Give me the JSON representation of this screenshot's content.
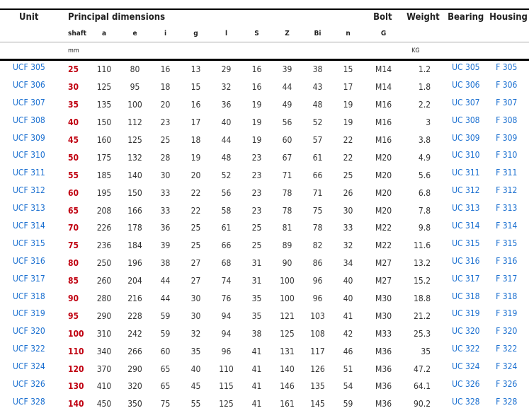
{
  "header": {
    "unit": "Unit",
    "principal": "Principal dimensions",
    "bolt": "Bolt",
    "weight": "Weight",
    "bearing": "Bearing",
    "housing": "Housing",
    "sub": [
      "shaft",
      "a",
      "e",
      "i",
      "g",
      "l",
      "S",
      "Z",
      "Bi",
      "n",
      "G"
    ],
    "unit_mm": "mm",
    "unit_kg": "KG"
  },
  "colors": {
    "link": "#1a6fd0",
    "shaft": "#c00010",
    "text": "#333333"
  },
  "rows": [
    [
      "UCF 305",
      "25",
      "110",
      "80",
      "16",
      "13",
      "29",
      "16",
      "39",
      "38",
      "15",
      "M14",
      "1.2",
      "UC 305",
      "F 305"
    ],
    [
      "UCF 306",
      "30",
      "125",
      "95",
      "18",
      "15",
      "32",
      "16",
      "44",
      "43",
      "17",
      "M14",
      "1.8",
      "UC 306",
      "F 306"
    ],
    [
      "UCF 307",
      "35",
      "135",
      "100",
      "20",
      "16",
      "36",
      "19",
      "49",
      "48",
      "19",
      "M16",
      "2.2",
      "UC 307",
      "F 307"
    ],
    [
      "UCF 308",
      "40",
      "150",
      "112",
      "23",
      "17",
      "40",
      "19",
      "56",
      "52",
      "19",
      "M16",
      "3",
      "UC 308",
      "F 308"
    ],
    [
      "UCF 309",
      "45",
      "160",
      "125",
      "25",
      "18",
      "44",
      "19",
      "60",
      "57",
      "22",
      "M16",
      "3.8",
      "UC 309",
      "F 309"
    ],
    [
      "UCF 310",
      "50",
      "175",
      "132",
      "28",
      "19",
      "48",
      "23",
      "67",
      "61",
      "22",
      "M20",
      "4.9",
      "UC 310",
      "F 310"
    ],
    [
      "UCF 311",
      "55",
      "185",
      "140",
      "30",
      "20",
      "52",
      "23",
      "71",
      "66",
      "25",
      "M20",
      "5.6",
      "UC 311",
      "F 311"
    ],
    [
      "UCF 312",
      "60",
      "195",
      "150",
      "33",
      "22",
      "56",
      "23",
      "78",
      "71",
      "26",
      "M20",
      "6.8",
      "UC 312",
      "F 312"
    ],
    [
      "UCF 313",
      "65",
      "208",
      "166",
      "33",
      "22",
      "58",
      "23",
      "78",
      "75",
      "30",
      "M20",
      "7.8",
      "UC 313",
      "F 313"
    ],
    [
      "UCF 314",
      "70",
      "226",
      "178",
      "36",
      "25",
      "61",
      "25",
      "81",
      "78",
      "33",
      "M22",
      "9.8",
      "UC 314",
      "F 314"
    ],
    [
      "UCF 315",
      "75",
      "236",
      "184",
      "39",
      "25",
      "66",
      "25",
      "89",
      "82",
      "32",
      "M22",
      "11.6",
      "UC 315",
      "F 315"
    ],
    [
      "UCF 316",
      "80",
      "250",
      "196",
      "38",
      "27",
      "68",
      "31",
      "90",
      "86",
      "34",
      "M27",
      "13.2",
      "UC 316",
      "F 316"
    ],
    [
      "UCF 317",
      "85",
      "260",
      "204",
      "44",
      "27",
      "74",
      "31",
      "100",
      "96",
      "40",
      "M27",
      "15.2",
      "UC 317",
      "F 317"
    ],
    [
      "UCF 318",
      "90",
      "280",
      "216",
      "44",
      "30",
      "76",
      "35",
      "100",
      "96",
      "40",
      "M30",
      "18.8",
      "UC 318",
      "F 318"
    ],
    [
      "UCF 319",
      "95",
      "290",
      "228",
      "59",
      "30",
      "94",
      "35",
      "121",
      "103",
      "41",
      "M30",
      "21.2",
      "UC 319",
      "F 319"
    ],
    [
      "UCF 320",
      "100",
      "310",
      "242",
      "59",
      "32",
      "94",
      "38",
      "125",
      "108",
      "42",
      "M33",
      "25.3",
      "UC 320",
      "F 320"
    ],
    [
      "UCF 322",
      "110",
      "340",
      "266",
      "60",
      "35",
      "96",
      "41",
      "131",
      "117",
      "46",
      "M36",
      "35",
      "UC 322",
      "F 322"
    ],
    [
      "UCF 324",
      "120",
      "370",
      "290",
      "65",
      "40",
      "110",
      "41",
      "140",
      "126",
      "51",
      "M36",
      "47.2",
      "UC 324",
      "F 324"
    ],
    [
      "UCF 326",
      "130",
      "410",
      "320",
      "65",
      "45",
      "115",
      "41",
      "146",
      "135",
      "54",
      "M36",
      "64.1",
      "UC 326",
      "F 326"
    ],
    [
      "UCF 328",
      "140",
      "450",
      "350",
      "75",
      "55",
      "125",
      "41",
      "161",
      "145",
      "59",
      "M36",
      "90.2",
      "UC 328",
      "F 328"
    ]
  ]
}
